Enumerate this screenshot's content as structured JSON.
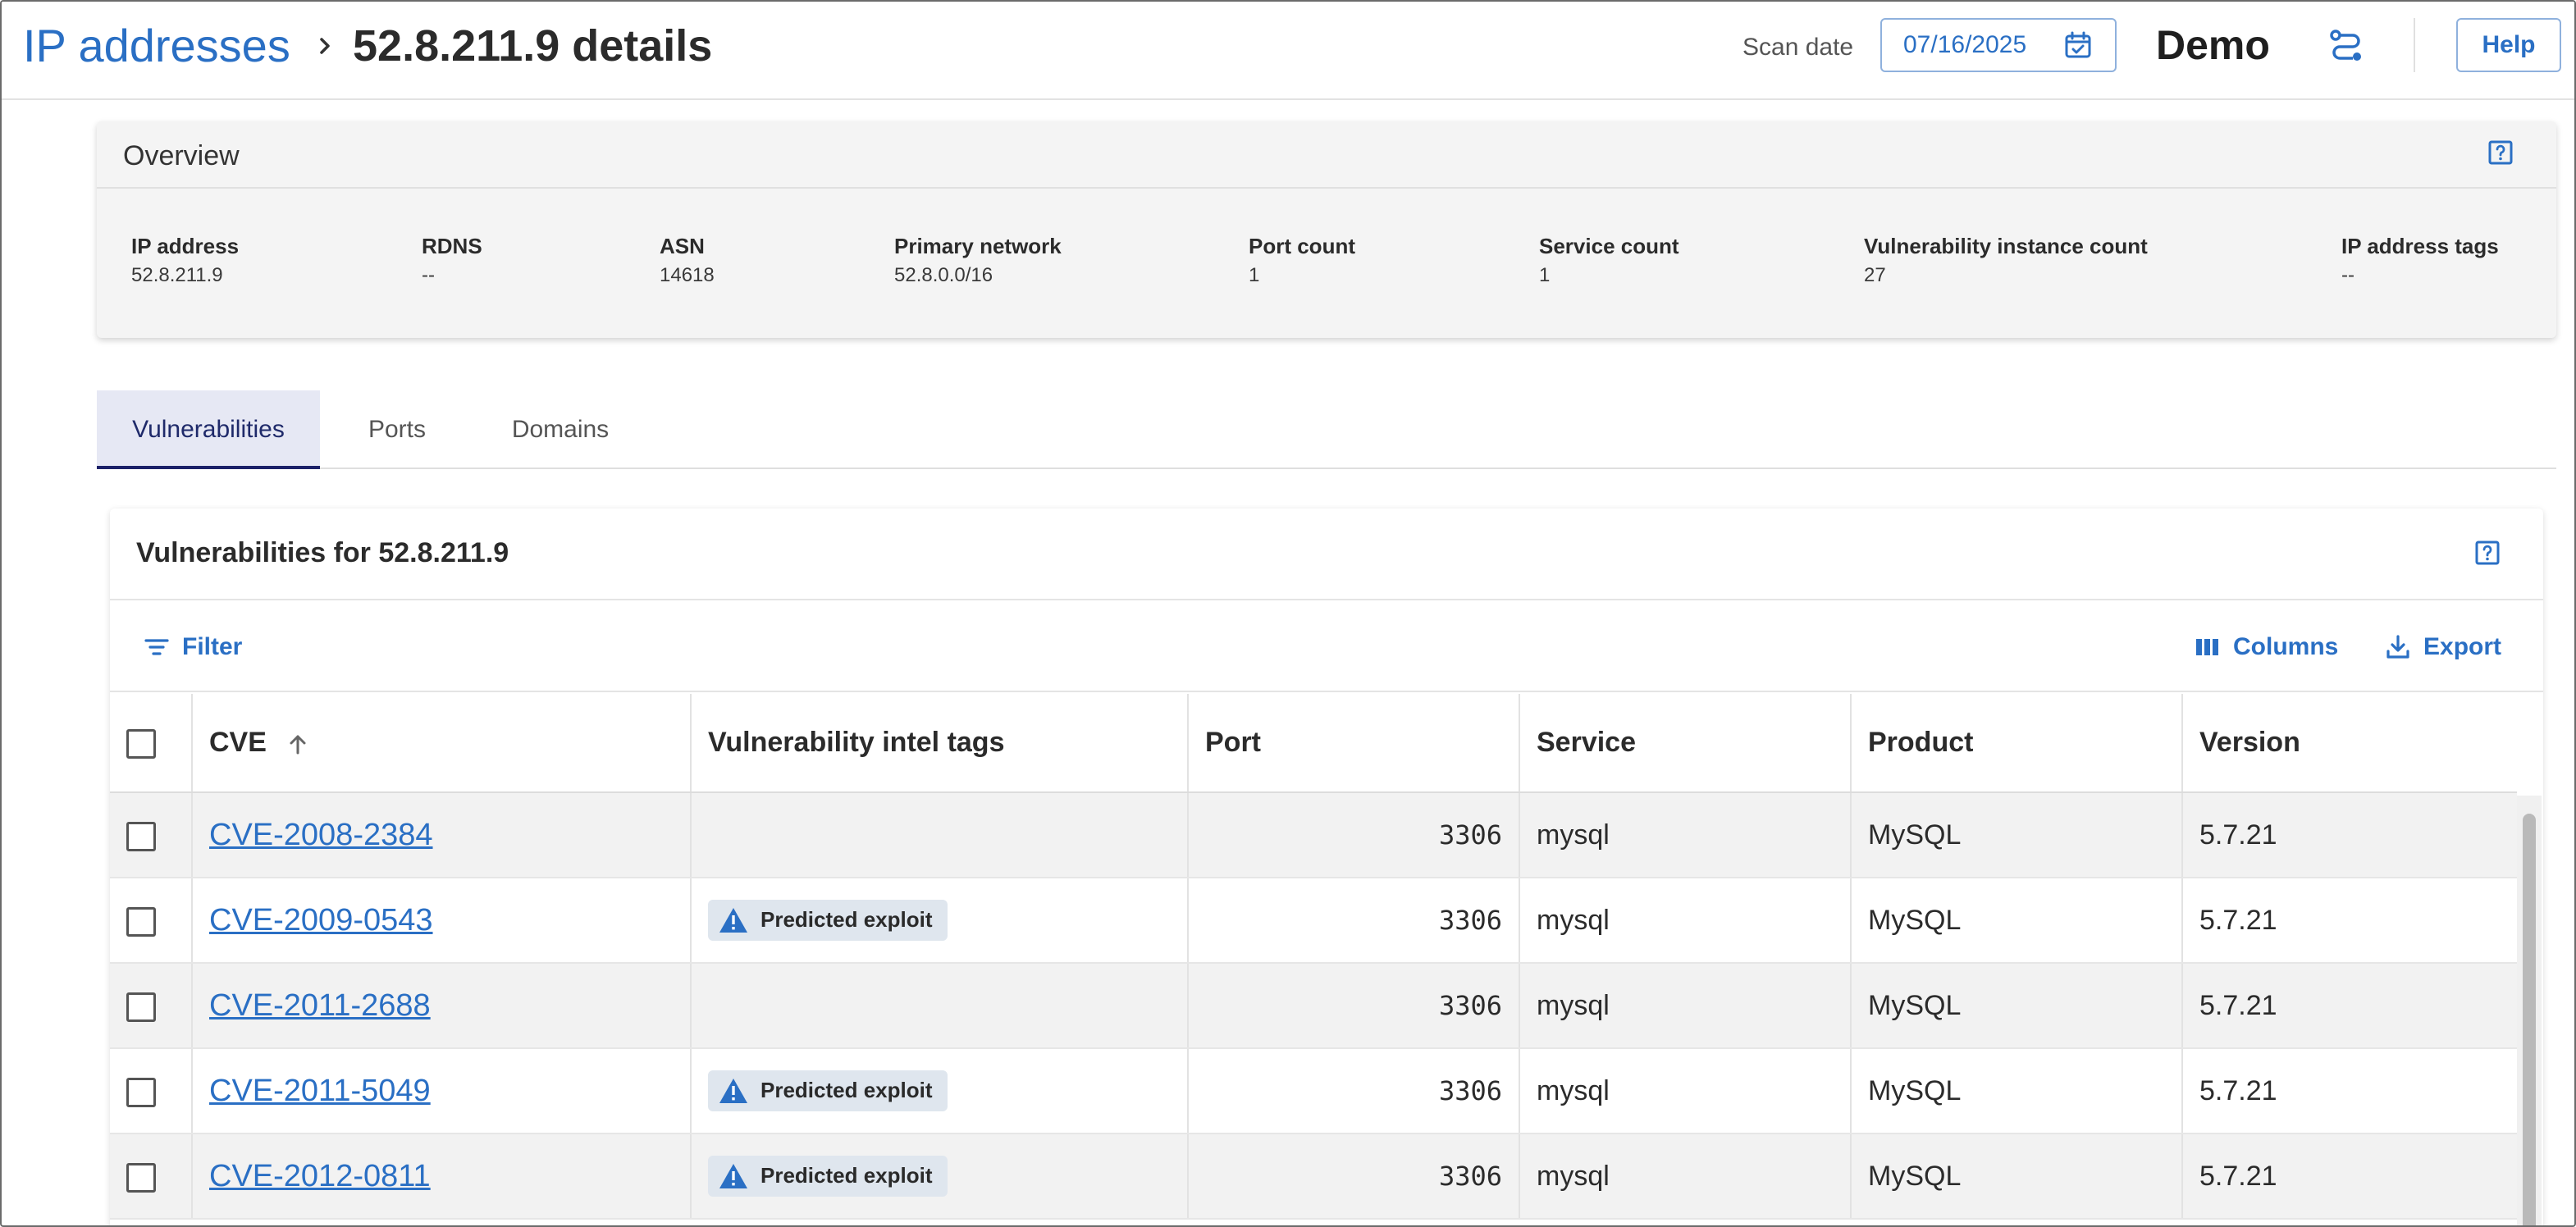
{
  "header": {
    "breadcrumb_link": "IP addresses",
    "breadcrumb_current": "52.8.211.9 details",
    "scan_date_label": "Scan date",
    "scan_date_value": "07/16/2025",
    "workspace": "Demo",
    "help_label": "Help"
  },
  "overview": {
    "title": "Overview",
    "fields": [
      {
        "label": "IP address",
        "value": "52.8.211.9"
      },
      {
        "label": "RDNS",
        "value": "--"
      },
      {
        "label": "ASN",
        "value": "14618"
      },
      {
        "label": "Primary network",
        "value": "52.8.0.0/16"
      },
      {
        "label": "Port count",
        "value": "1"
      },
      {
        "label": "Service count",
        "value": "1"
      },
      {
        "label": "Vulnerability instance count",
        "value": "27"
      },
      {
        "label": "IP address tags",
        "value": "--"
      }
    ]
  },
  "tabs": [
    {
      "label": "Vulnerabilities",
      "active": true
    },
    {
      "label": "Ports",
      "active": false
    },
    {
      "label": "Domains",
      "active": false
    }
  ],
  "vulnerabilities": {
    "title": "Vulnerabilities for 52.8.211.9",
    "toolbar": {
      "filter": "Filter",
      "columns": "Columns",
      "export": "Export"
    },
    "columns": [
      "CVE",
      "Vulnerability intel tags",
      "Port",
      "Service",
      "Product",
      "Version"
    ],
    "rows": [
      {
        "cve": "CVE-2008-2384",
        "tag": "",
        "port": "3306",
        "service": "mysql",
        "product": "MySQL",
        "version": "5.7.21"
      },
      {
        "cve": "CVE-2009-0543",
        "tag": "Predicted exploit",
        "port": "3306",
        "service": "mysql",
        "product": "MySQL",
        "version": "5.7.21"
      },
      {
        "cve": "CVE-2011-2688",
        "tag": "",
        "port": "3306",
        "service": "mysql",
        "product": "MySQL",
        "version": "5.7.21"
      },
      {
        "cve": "CVE-2011-5049",
        "tag": "Predicted exploit",
        "port": "3306",
        "service": "mysql",
        "product": "MySQL",
        "version": "5.7.21"
      },
      {
        "cve": "CVE-2012-0811",
        "tag": "Predicted exploit",
        "port": "3306",
        "service": "mysql",
        "product": "MySQL",
        "version": "5.7.21"
      }
    ]
  },
  "colors": {
    "link": "#2a6fc4",
    "tab_active_bg": "#e6e8f4",
    "tab_active_border": "#1c2168",
    "tag_bg": "#dfe6ee",
    "warning_icon": "#2a6fc4"
  },
  "icons": {
    "breadcrumb_separator": "chevron-right-icon",
    "date_picker": "calendar-check-icon",
    "workspace_switch": "route-icon",
    "help": "question-square-icon",
    "sort": "arrow-up-icon",
    "filter": "filter-lines-icon",
    "columns": "columns-icon",
    "export": "download-icon",
    "tag": "warning-triangle-icon"
  }
}
